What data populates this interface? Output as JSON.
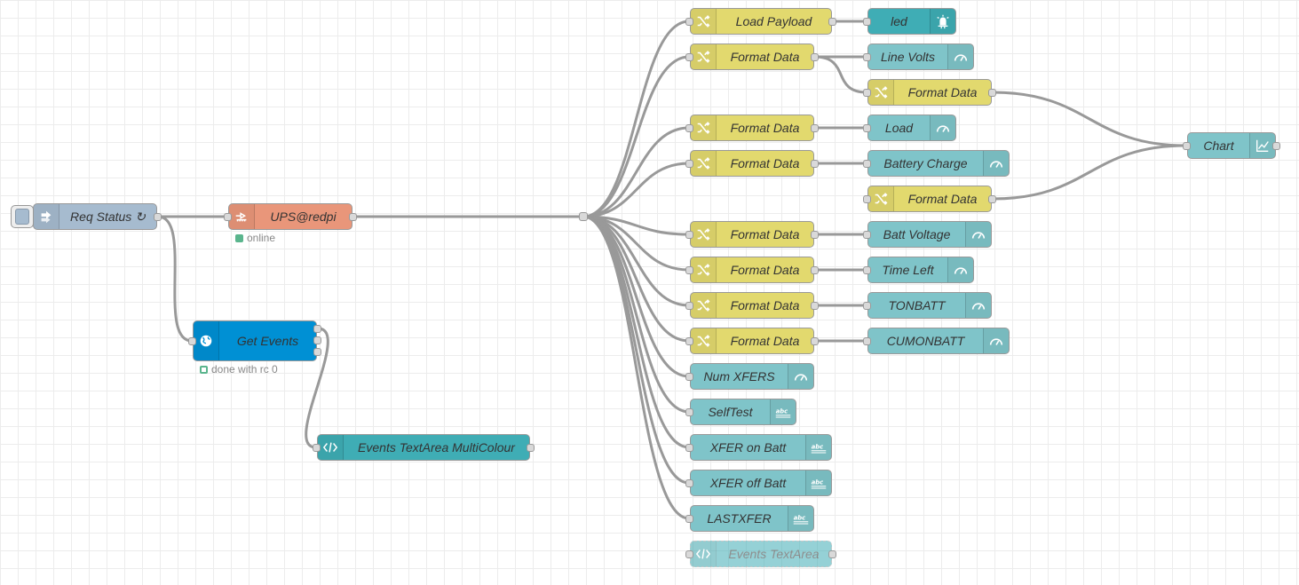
{
  "colors": {
    "change": "#e2d96e",
    "dashboard": "#7fc4c9",
    "led": "#3fadb5",
    "inject": "#a6bbcf",
    "exec": "#e9967a",
    "http": "#0090d4",
    "template": "#3fadb5",
    "wire": "#999999"
  },
  "nodes": [
    {
      "id": "req",
      "label": "Req Status ↻",
      "icon": "inject-arrow-icon",
      "type": "inject"
    },
    {
      "id": "ups",
      "label": "UPS@redpi",
      "icon": "exec-icon",
      "type": "exec",
      "status": "online",
      "status_color": "#5ab58d"
    },
    {
      "id": "get",
      "label": "Get Events",
      "icon": "globe-icon",
      "type": "http",
      "status": "done with rc 0",
      "status_color": "#5ab58d"
    },
    {
      "id": "evmc",
      "label": "Events TextArea MultiColour",
      "icon": "code-icon",
      "type": "template"
    },
    {
      "id": "lp",
      "label": "Load Payload",
      "icon": "shuffle-icon",
      "type": "change"
    },
    {
      "id": "fd1",
      "label": "Format Data",
      "icon": "shuffle-icon",
      "type": "change"
    },
    {
      "id": "fd2",
      "label": "Format Data",
      "icon": "shuffle-icon",
      "type": "change"
    },
    {
      "id": "fd3",
      "label": "Format Data",
      "icon": "shuffle-icon",
      "type": "change"
    },
    {
      "id": "fd4",
      "label": "Format Data",
      "icon": "shuffle-icon",
      "type": "change"
    },
    {
      "id": "fd5",
      "label": "Format Data",
      "icon": "shuffle-icon",
      "type": "change"
    },
    {
      "id": "fd6",
      "label": "Format Data",
      "icon": "shuffle-icon",
      "type": "change"
    },
    {
      "id": "fd7",
      "label": "Format Data",
      "icon": "shuffle-icon",
      "type": "change"
    },
    {
      "id": "fdA",
      "label": "Format Data",
      "icon": "shuffle-icon",
      "type": "change"
    },
    {
      "id": "fdB",
      "label": "Format Data",
      "icon": "shuffle-icon",
      "type": "change"
    },
    {
      "id": "numx",
      "label": "Num XFERS",
      "icon": "gauge-icon",
      "type": "dashboard"
    },
    {
      "id": "self",
      "label": "SelfTest",
      "icon": "text-icon",
      "type": "dashboard"
    },
    {
      "id": "xon",
      "label": "XFER on Batt",
      "icon": "text-icon",
      "type": "dashboard"
    },
    {
      "id": "xoff",
      "label": "XFER off Batt",
      "icon": "text-icon",
      "type": "dashboard"
    },
    {
      "id": "lastx",
      "label": "LASTXFER",
      "icon": "text-icon",
      "type": "dashboard"
    },
    {
      "id": "evta",
      "label": "Events TextArea",
      "icon": "code-icon",
      "type": "template",
      "disabled": true
    },
    {
      "id": "led",
      "label": "led",
      "icon": "led-icon",
      "type": "led"
    },
    {
      "id": "lv",
      "label": "Line Volts",
      "icon": "gauge-icon",
      "type": "dashboard"
    },
    {
      "id": "load",
      "label": "Load",
      "icon": "gauge-icon",
      "type": "dashboard"
    },
    {
      "id": "bc",
      "label": "Battery Charge",
      "icon": "gauge-icon",
      "type": "dashboard"
    },
    {
      "id": "bv",
      "label": "Batt Voltage",
      "icon": "gauge-icon",
      "type": "dashboard"
    },
    {
      "id": "tl",
      "label": "Time Left",
      "icon": "gauge-icon",
      "type": "dashboard"
    },
    {
      "id": "tonb",
      "label": "TONBATT",
      "icon": "gauge-icon",
      "type": "dashboard"
    },
    {
      "id": "cumb",
      "label": "CUMONBATT",
      "icon": "gauge-icon",
      "type": "dashboard"
    },
    {
      "id": "chart",
      "label": "Chart",
      "icon": "chart-icon",
      "type": "dashboard"
    }
  ]
}
